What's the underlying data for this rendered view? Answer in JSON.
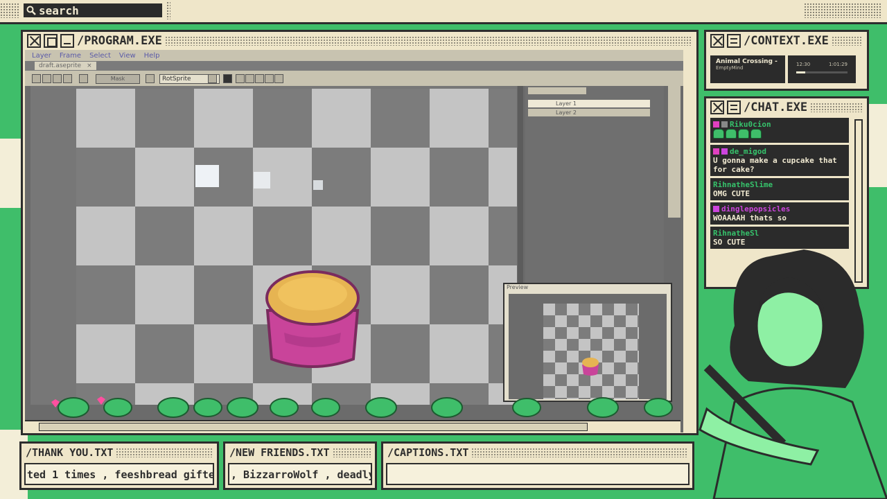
{
  "search": {
    "placeholder": "search"
  },
  "program": {
    "title": "/PROGRAM.EXE",
    "menu": [
      "Layer",
      "Frame",
      "Select",
      "View",
      "Help"
    ],
    "tab_label": "draft.aseprite",
    "toolbar": {
      "resize_label": "Mask",
      "rotation_algo": "RotSprite"
    },
    "layers": [
      "Layer 1",
      "Layer 2"
    ],
    "preview_title": "Preview"
  },
  "context": {
    "title": "/CONTEXT.EXE",
    "song_title": "Animal Crossing -",
    "song_artist": "EmptyMind",
    "elapsed": "12:30",
    "duration": "1:01:29",
    "progress": 0.18
  },
  "chat": {
    "title": "/CHAT.EXE",
    "messages": [
      {
        "user": "Riku0cion",
        "text": "",
        "color": "#36c26b"
      },
      {
        "user": "de_migod",
        "text": "U gonna make a cupcake that for cake?",
        "color": "#36c26b"
      },
      {
        "user": "RihnatheSlime",
        "text": "OMG CUTE",
        "color": "#36c26b"
      },
      {
        "user": "dinglepopsicles",
        "text": "WOAAAAH thats so",
        "color": "#cc44dd"
      },
      {
        "user": "RihnatheSl",
        "text": "SO CUTE",
        "color": "#36c26b"
      }
    ]
  },
  "tickers": {
    "thanks": {
      "title": "/THANK YOU.TXT",
      "text": "ted 1 times , feeshbread gifte"
    },
    "friends": {
      "title": "/NEW FRIENDS.TXT",
      "text": ", BizzarroWolf , deadly"
    },
    "captions": {
      "title": "/CAPTIONS.TXT",
      "text": ""
    }
  },
  "colors": {
    "accent_green": "#3fbe6a",
    "cream": "#efe6c9",
    "dark": "#2d2d2d",
    "cupcake_pink": "#c9449a",
    "cupcake_top": "#e6b452"
  }
}
